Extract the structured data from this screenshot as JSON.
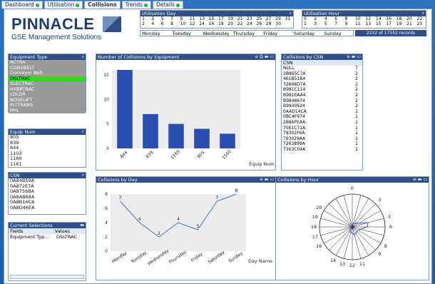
{
  "tabs": [
    {
      "label": "Dashboard",
      "dot": true,
      "active": false
    },
    {
      "label": "Utilisation",
      "dot": true,
      "active": false
    },
    {
      "label": "Collisions",
      "dot": false,
      "active": true
    },
    {
      "label": "Trends",
      "dot": true,
      "active": false
    },
    {
      "label": "Details",
      "dot": true,
      "active": false
    }
  ],
  "logo": {
    "title": "PINNACLE",
    "subtitle": "GSE Management Solutions"
  },
  "utilisation_day": {
    "title": "Utilisation Day",
    "row1": [
      "1",
      "3",
      "5",
      "7",
      "9",
      "11",
      "13",
      "15",
      "17",
      "19",
      "21",
      "23",
      "25",
      "27",
      "29",
      "31"
    ],
    "row2": [
      "2",
      "4",
      "6",
      "8",
      "10",
      "12",
      "14",
      "16",
      "18",
      "20",
      "22",
      "24",
      "26",
      "28",
      "30"
    ]
  },
  "utilisation_hour": {
    "title": "Utilisation Hour",
    "row1": [
      "0",
      "2",
      "4",
      "6",
      "8",
      "10",
      "12",
      "14",
      "16",
      "18",
      "20",
      "22"
    ],
    "row2": [
      "1",
      "3",
      "5",
      "7",
      "9",
      "11",
      "13",
      "15",
      "17",
      "19",
      "21",
      "23"
    ]
  },
  "weekdays": [
    "Monday",
    "Tuesday",
    "Wednesday",
    "Thursday",
    "Friday",
    "Saturday",
    "Sunday"
  ],
  "records": "2232 of 17552 records",
  "equipment_type": {
    "title": "Equipment Type",
    "items": [
      "ACTRA",
      "CONVBELT",
      "Conveyor Belt",
      "DSLTRAC",
      "ELECTRAC",
      "HYBRTRAC",
      "LDLDR",
      "NOSELIFT",
      "PLTTRANS",
      "PPS"
    ],
    "selected": "DSLTRAC"
  },
  "equip_num": {
    "title": "Equip Num",
    "items": [
      "805",
      "839",
      "844",
      "1103",
      "1160",
      "1161"
    ]
  },
  "csn_list": {
    "title": "CSN",
    "items": [
      "0A84B59A",
      "0A872E7A",
      "0A8756BA",
      "0A8AB68A",
      "0A8B14CA",
      "0A8D46EA"
    ]
  },
  "current_selections": {
    "title": "Current Selections",
    "fields_header": "Fields",
    "values_header": "Values",
    "field": "Equipment Typ...",
    "value": "DSLTRAC"
  },
  "csn_table": {
    "title": "Collisions by CSN",
    "header": "CSN",
    "rows": [
      [
        "NULL",
        "7"
      ],
      [
        "2B865C7A",
        "2"
      ],
      [
        "461B51B4",
        "2"
      ],
      [
        "72668D7A",
        "2"
      ],
      [
        "B981C114",
        "2"
      ],
      [
        "B981EAA4",
        "2"
      ],
      [
        "B9848674",
        "2"
      ],
      [
        "B9930524",
        "2"
      ],
      [
        "0AAD14CA",
        "1"
      ],
      [
        "0BC4F974",
        "1"
      ],
      [
        "2B86FEAA",
        "1"
      ],
      [
        "75E1C71A",
        "1"
      ],
      [
        "79302F6A",
        "1"
      ],
      [
        "793029AA",
        "1"
      ],
      [
        "7263899A",
        "1"
      ],
      [
        "7363C04A",
        "1"
      ]
    ]
  },
  "chart_data": [
    {
      "type": "bar",
      "title": "Number of Collisions by Equipment",
      "categories": [
        "844",
        "839",
        "1169",
        "805",
        "1160"
      ],
      "values": [
        16,
        7,
        5,
        4,
        3
      ],
      "ylim": [
        0,
        16
      ],
      "yticks": [
        0,
        5,
        10,
        15
      ],
      "xlabel": "Equip Num",
      "ylabel": ""
    },
    {
      "type": "line",
      "title": "Collisions by Day",
      "categories": [
        "Monday",
        "Tuesday",
        "Wednesday",
        "Thursday",
        "Friday",
        "Saturday",
        "Sunday"
      ],
      "values": [
        7,
        4,
        2,
        4,
        3,
        7,
        8
      ],
      "ylim": [
        0,
        8
      ],
      "yticks": [
        0,
        2,
        4,
        6,
        8
      ],
      "xlabel": "Day Name",
      "ylabel": ""
    },
    {
      "type": "radar",
      "title": "Collisions by Hour",
      "categories": [
        "0",
        "3",
        "5",
        "6",
        "8",
        "9",
        "11",
        "12",
        "13",
        "14",
        "16",
        "17",
        "18",
        "19",
        "20"
      ]
    }
  ]
}
